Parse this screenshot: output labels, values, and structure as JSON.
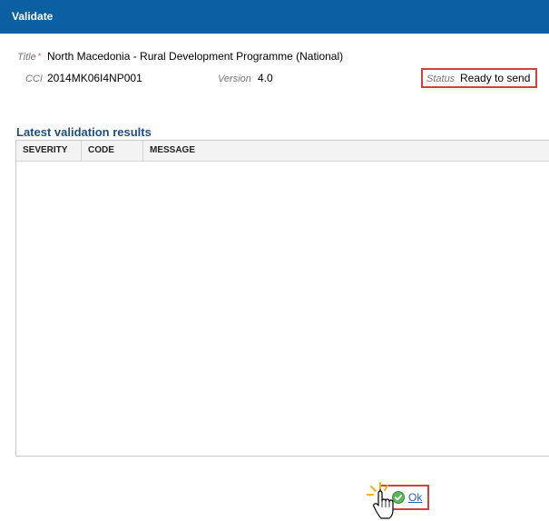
{
  "dialog": {
    "title": "Validate"
  },
  "fields": {
    "title_label": "Title",
    "title_required": "*",
    "title_value": "North Macedonia - Rural Development Programme (National)",
    "cci_label": "CCI",
    "cci_value": "2014MK06I4NP001",
    "version_label": "Version",
    "version_value": "4.0",
    "status_label": "Status",
    "status_value": "Ready to send"
  },
  "results": {
    "section_title": "Latest validation results",
    "columns": [
      "SEVERITY",
      "CODE",
      "MESSAGE"
    ],
    "rows": []
  },
  "actions": {
    "ok_label": "Ok"
  },
  "colors": {
    "titlebar": "#0a60a1",
    "highlight": "#d24040",
    "section_title": "#1d4f86"
  },
  "icons": [
    "check-icon",
    "hand-pointer-cursor-icon"
  ]
}
